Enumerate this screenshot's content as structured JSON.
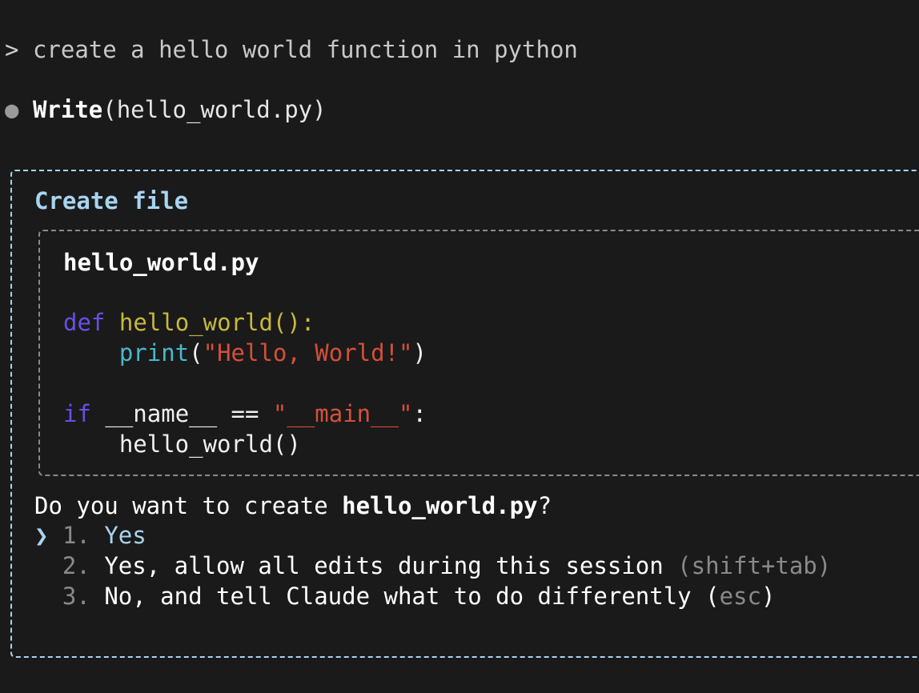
{
  "prompt": {
    "chevron": ">",
    "text": "create a hello world function in python"
  },
  "tool_call": {
    "bullet": "●",
    "name": "Write",
    "args": "(hello_world.py)"
  },
  "dialog": {
    "title": "Create file",
    "file": {
      "name": "hello_world.py",
      "code": {
        "line1_kw": "def",
        "line1_fn": "hello_world():",
        "line2_builtin": "print",
        "line2_open": "(",
        "line2_str": "\"Hello, World!\"",
        "line2_close": ")",
        "line3_kw": "if",
        "line3_plain": "__name__ ==",
        "line3_str": "\"__main__\"",
        "line3_colon": ":",
        "line4_plain": "hello_world()"
      }
    },
    "question_prefix": "Do you want to create",
    "question_file": "hello_world.py",
    "question_suffix": "?",
    "options": [
      {
        "marker": "❯",
        "num": "1.",
        "label": "Yes",
        "hint": ""
      },
      {
        "marker": "",
        "num": "2.",
        "label": "Yes, allow all edits during this session",
        "hint": "(shift+tab)"
      },
      {
        "marker": "",
        "num": "3.",
        "label": "No, and tell Claude what to do differently",
        "hint_open": "(",
        "hint": "esc",
        "hint_close": ")"
      }
    ]
  },
  "colors": {
    "background": "#1a1a1a",
    "accent": "#a9d4f0",
    "keyword": "#6a4ee8",
    "function": "#c9b93c",
    "builtin": "#49b8c9",
    "string": "#d4503a",
    "muted": "#8a8a8a"
  }
}
